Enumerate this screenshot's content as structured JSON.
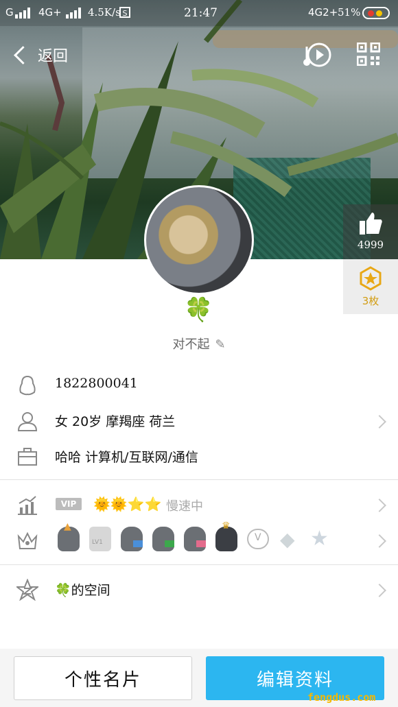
{
  "status_bar": {
    "signal_left": "G",
    "network": "4G+",
    "speed": "4.5K/s",
    "time": "21:47",
    "network_right": "4G2+",
    "battery": "51%"
  },
  "nav": {
    "back_label": "返回"
  },
  "hero": {
    "like_count": "4999",
    "badge_count": "3枚"
  },
  "profile": {
    "nickname_emoji": "🍀",
    "signature": "对不起",
    "qq_number": "1822800041",
    "basic_info": "女  20岁   摩羯座   荷兰",
    "career": "哈哈 计算机/互联网/通信"
  },
  "vip": {
    "vip_label": "VIP",
    "suns": "🌞🌞⭐⭐",
    "speed_status": "慢速中"
  },
  "medals": {
    "icons": [
      "qq-penguin-badge",
      "lv1-diamond-badge",
      "penguin-blue-badge",
      "penguin-green-badge",
      "penguin-pink-badge",
      "penguin-crown-badge",
      "cloud-v-badge",
      "diamond-badge",
      "star-badge"
    ]
  },
  "space": {
    "label": "🍀的空间"
  },
  "buttons": {
    "card": "个性名片",
    "edit": "编辑资料"
  },
  "watermark": "fengdus.com",
  "colors": {
    "accent": "#2cb6f0",
    "badge_gold": "#d29d12"
  }
}
